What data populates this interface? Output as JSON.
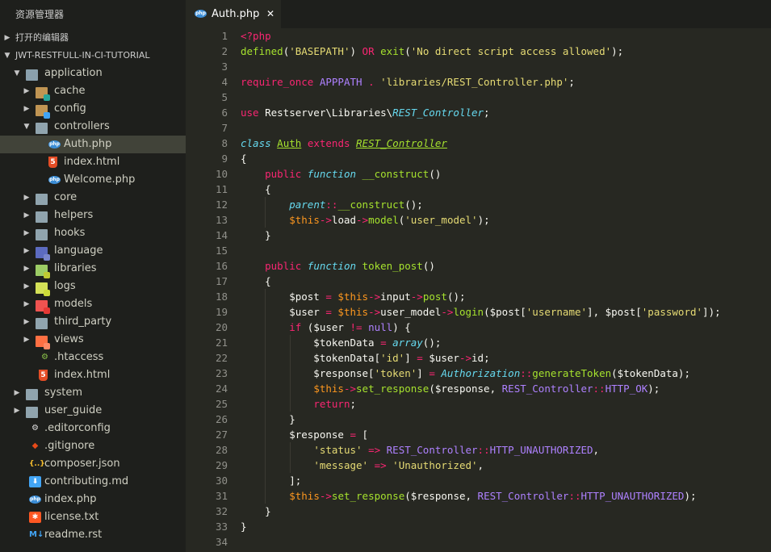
{
  "sidebar": {
    "title": "资源管理器",
    "open_editors": "打开的编辑器",
    "project": "JWT-RESTFULL-IN-CI-TUTORIAL",
    "items": [
      {
        "name": "application",
        "depth": 1,
        "type": "folder-open",
        "color": "#8aa0ad"
      },
      {
        "name": "cache",
        "depth": 2,
        "type": "folder",
        "color": "#c09553",
        "badge": "#26a69a"
      },
      {
        "name": "config",
        "depth": 2,
        "type": "folder",
        "color": "#c09553",
        "badge": "#42a5f5"
      },
      {
        "name": "controllers",
        "depth": 2,
        "type": "folder-open",
        "color": "#90a4ae"
      },
      {
        "name": "Auth.php",
        "depth": 3,
        "type": "php",
        "selected": true
      },
      {
        "name": "index.html",
        "depth": 3,
        "type": "html"
      },
      {
        "name": "Welcome.php",
        "depth": 3,
        "type": "php"
      },
      {
        "name": "core",
        "depth": 2,
        "type": "folder",
        "color": "#90a4ae"
      },
      {
        "name": "helpers",
        "depth": 2,
        "type": "folder",
        "color": "#90a4ae"
      },
      {
        "name": "hooks",
        "depth": 2,
        "type": "folder",
        "color": "#90a4ae"
      },
      {
        "name": "language",
        "depth": 2,
        "type": "folder",
        "color": "#5c6bc0",
        "badge": "#7986cb"
      },
      {
        "name": "libraries",
        "depth": 2,
        "type": "folder",
        "color": "#9ccc65",
        "badge": "#c0ca33"
      },
      {
        "name": "logs",
        "depth": 2,
        "type": "folder",
        "color": "#d4e157",
        "badge": "#cddc39"
      },
      {
        "name": "models",
        "depth": 2,
        "type": "folder",
        "color": "#ef5350",
        "badge": "#e53935"
      },
      {
        "name": "third_party",
        "depth": 2,
        "type": "folder",
        "color": "#90a4ae"
      },
      {
        "name": "views",
        "depth": 2,
        "type": "folder",
        "color": "#ff7043",
        "badge": "#ff8a65"
      },
      {
        "name": ".htaccess",
        "depth": 2,
        "type": "htaccess"
      },
      {
        "name": "index.html",
        "depth": 2,
        "type": "html"
      },
      {
        "name": "system",
        "depth": 1,
        "type": "folder",
        "color": "#90a4ae"
      },
      {
        "name": "user_guide",
        "depth": 1,
        "type": "folder",
        "color": "#90a4ae"
      },
      {
        "name": ".editorconfig",
        "depth": 1,
        "type": "editorconfig"
      },
      {
        "name": ".gitignore",
        "depth": 1,
        "type": "git"
      },
      {
        "name": "composer.json",
        "depth": 1,
        "type": "json"
      },
      {
        "name": "contributing.md",
        "depth": 1,
        "type": "md"
      },
      {
        "name": "index.php",
        "depth": 1,
        "type": "php"
      },
      {
        "name": "license.txt",
        "depth": 1,
        "type": "license"
      },
      {
        "name": "readme.rst",
        "depth": 1,
        "type": "rst"
      }
    ]
  },
  "tab": {
    "label": "Auth.php",
    "icon_label": "php",
    "close": "✕"
  },
  "editor": {
    "lines": [
      [
        [
          "t-tag",
          "<?php"
        ]
      ],
      [
        [
          "t-fn",
          "defined"
        ],
        [
          "t-plain",
          "("
        ],
        [
          "t-str",
          "'BASEPATH'"
        ],
        [
          "t-plain",
          ") "
        ],
        [
          "t-kw",
          "OR"
        ],
        [
          "t-plain",
          " "
        ],
        [
          "t-fn",
          "exit"
        ],
        [
          "t-plain",
          "("
        ],
        [
          "t-str",
          "'No direct script access allowed'"
        ],
        [
          "t-plain",
          ");"
        ]
      ],
      [],
      [
        [
          "t-kw",
          "require_once"
        ],
        [
          "t-plain",
          " "
        ],
        [
          "t-const",
          "APPPATH"
        ],
        [
          "t-plain",
          " "
        ],
        [
          "t-kw",
          "."
        ],
        [
          "t-plain",
          " "
        ],
        [
          "t-str",
          "'libraries/REST_Controller.php'"
        ],
        [
          "t-plain",
          ";"
        ]
      ],
      [],
      [
        [
          "t-kw",
          "use"
        ],
        [
          "t-plain",
          " Restserver\\Libraries\\"
        ],
        [
          "t-cls-i",
          "REST_Controller"
        ],
        [
          "t-plain",
          ";"
        ]
      ],
      [],
      [
        [
          "t-sto",
          "class"
        ],
        [
          "t-plain",
          " "
        ],
        [
          "t-cls-u",
          "Auth"
        ],
        [
          "t-plain",
          " "
        ],
        [
          "t-kw",
          "extends"
        ],
        [
          "t-plain",
          " "
        ],
        [
          "t-cls-ui",
          "REST_Controller"
        ]
      ],
      [
        [
          "t-plain",
          "{"
        ]
      ],
      [
        [
          "t-plain",
          "    "
        ],
        [
          "t-kw",
          "public"
        ],
        [
          "t-plain",
          " "
        ],
        [
          "t-sto",
          "function"
        ],
        [
          "t-plain",
          " "
        ],
        [
          "t-fn",
          "__construct"
        ],
        [
          "t-plain",
          "()"
        ]
      ],
      [
        [
          "t-plain",
          "    {"
        ]
      ],
      [
        [
          "t-plain",
          "        "
        ],
        [
          "t-sto",
          "parent"
        ],
        [
          "t-kw",
          "::"
        ],
        [
          "t-fn",
          "__construct"
        ],
        [
          "t-plain",
          "();"
        ]
      ],
      [
        [
          "t-plain",
          "        "
        ],
        [
          "t-this",
          "$this"
        ],
        [
          "t-kw",
          "->"
        ],
        [
          "t-plain",
          "load"
        ],
        [
          "t-kw",
          "->"
        ],
        [
          "t-fn",
          "model"
        ],
        [
          "t-plain",
          "("
        ],
        [
          "t-str",
          "'user_model'"
        ],
        [
          "t-plain",
          ");"
        ]
      ],
      [
        [
          "t-plain",
          "    }"
        ]
      ],
      [],
      [
        [
          "t-plain",
          "    "
        ],
        [
          "t-kw",
          "public"
        ],
        [
          "t-plain",
          " "
        ],
        [
          "t-sto",
          "function"
        ],
        [
          "t-plain",
          " "
        ],
        [
          "t-fn",
          "token_post"
        ],
        [
          "t-plain",
          "()"
        ]
      ],
      [
        [
          "t-plain",
          "    {"
        ]
      ],
      [
        [
          "t-plain",
          "        $post "
        ],
        [
          "t-kw",
          "="
        ],
        [
          "t-plain",
          " "
        ],
        [
          "t-this",
          "$this"
        ],
        [
          "t-kw",
          "->"
        ],
        [
          "t-plain",
          "input"
        ],
        [
          "t-kw",
          "->"
        ],
        [
          "t-fn",
          "post"
        ],
        [
          "t-plain",
          "();"
        ]
      ],
      [
        [
          "t-plain",
          "        $user "
        ],
        [
          "t-kw",
          "="
        ],
        [
          "t-plain",
          " "
        ],
        [
          "t-this",
          "$this"
        ],
        [
          "t-kw",
          "->"
        ],
        [
          "t-plain",
          "user_model"
        ],
        [
          "t-kw",
          "->"
        ],
        [
          "t-fn",
          "login"
        ],
        [
          "t-plain",
          "($post["
        ],
        [
          "t-str",
          "'username'"
        ],
        [
          "t-plain",
          "], $post["
        ],
        [
          "t-str",
          "'password'"
        ],
        [
          "t-plain",
          "]);"
        ]
      ],
      [
        [
          "t-plain",
          "        "
        ],
        [
          "t-kw",
          "if"
        ],
        [
          "t-plain",
          " ($user "
        ],
        [
          "t-kw",
          "!="
        ],
        [
          "t-plain",
          " "
        ],
        [
          "t-const",
          "null"
        ],
        [
          "t-plain",
          ") {"
        ]
      ],
      [
        [
          "t-plain",
          "            $tokenData "
        ],
        [
          "t-kw",
          "="
        ],
        [
          "t-plain",
          " "
        ],
        [
          "t-sto",
          "array"
        ],
        [
          "t-plain",
          "();"
        ]
      ],
      [
        [
          "t-plain",
          "            $tokenData["
        ],
        [
          "t-str",
          "'id'"
        ],
        [
          "t-plain",
          "] "
        ],
        [
          "t-kw",
          "="
        ],
        [
          "t-plain",
          " $user"
        ],
        [
          "t-kw",
          "->"
        ],
        [
          "t-plain",
          "id;"
        ]
      ],
      [
        [
          "t-plain",
          "            $response["
        ],
        [
          "t-str",
          "'token'"
        ],
        [
          "t-plain",
          "] "
        ],
        [
          "t-kw",
          "="
        ],
        [
          "t-plain",
          " "
        ],
        [
          "t-cls-i",
          "Authorization"
        ],
        [
          "t-kw",
          "::"
        ],
        [
          "t-fn",
          "generateToken"
        ],
        [
          "t-plain",
          "($tokenData);"
        ]
      ],
      [
        [
          "t-plain",
          "            "
        ],
        [
          "t-this",
          "$this"
        ],
        [
          "t-kw",
          "->"
        ],
        [
          "t-fn",
          "set_response"
        ],
        [
          "t-plain",
          "($response, "
        ],
        [
          "t-const",
          "REST_Controller"
        ],
        [
          "t-kw",
          "::"
        ],
        [
          "t-const",
          "HTTP_OK"
        ],
        [
          "t-plain",
          ");"
        ]
      ],
      [
        [
          "t-plain",
          "            "
        ],
        [
          "t-kw",
          "return"
        ],
        [
          "t-plain",
          ";"
        ]
      ],
      [
        [
          "t-plain",
          "        }"
        ]
      ],
      [
        [
          "t-plain",
          "        $response "
        ],
        [
          "t-kw",
          "="
        ],
        [
          "t-plain",
          " ["
        ]
      ],
      [
        [
          "t-plain",
          "            "
        ],
        [
          "t-str",
          "'status'"
        ],
        [
          "t-plain",
          " "
        ],
        [
          "t-kw",
          "=>"
        ],
        [
          "t-plain",
          " "
        ],
        [
          "t-const",
          "REST_Controller"
        ],
        [
          "t-kw",
          "::"
        ],
        [
          "t-const",
          "HTTP_UNAUTHORIZED"
        ],
        [
          "t-plain",
          ","
        ]
      ],
      [
        [
          "t-plain",
          "            "
        ],
        [
          "t-str",
          "'message'"
        ],
        [
          "t-plain",
          " "
        ],
        [
          "t-kw",
          "=>"
        ],
        [
          "t-plain",
          " "
        ],
        [
          "t-str",
          "'Unauthorized'"
        ],
        [
          "t-plain",
          ","
        ]
      ],
      [
        [
          "t-plain",
          "        ];"
        ]
      ],
      [
        [
          "t-plain",
          "        "
        ],
        [
          "t-this",
          "$this"
        ],
        [
          "t-kw",
          "->"
        ],
        [
          "t-fn",
          "set_response"
        ],
        [
          "t-plain",
          "($response, "
        ],
        [
          "t-const",
          "REST_Controller"
        ],
        [
          "t-kw",
          "::"
        ],
        [
          "t-const",
          "HTTP_UNAUTHORIZED"
        ],
        [
          "t-plain",
          ");"
        ]
      ],
      [
        [
          "t-plain",
          "    }"
        ]
      ],
      [
        [
          "t-plain",
          "}"
        ]
      ],
      []
    ]
  }
}
